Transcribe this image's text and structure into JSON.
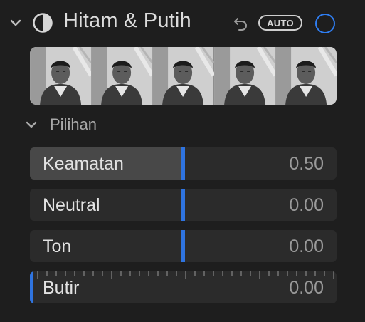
{
  "header": {
    "title": "Hitam & Putih",
    "auto_label": "AUTO",
    "accent_color": "#2f7ef2",
    "icons": [
      "chevron-down-icon",
      "black-white-icon",
      "undo-icon",
      "toggle-circle-icon"
    ]
  },
  "thumbnails": {
    "count": 5
  },
  "options": {
    "label": "Pilihan"
  },
  "sliders": [
    {
      "label": "Keamatan",
      "value": "0.50",
      "level": 0.5
    },
    {
      "label": "Neutral",
      "value": "0.00",
      "level": 0.5
    },
    {
      "label": "Ton",
      "value": "0.00",
      "level": 0.5
    },
    {
      "label": "Butir",
      "value": "0.00",
      "level": 0.0
    }
  ]
}
